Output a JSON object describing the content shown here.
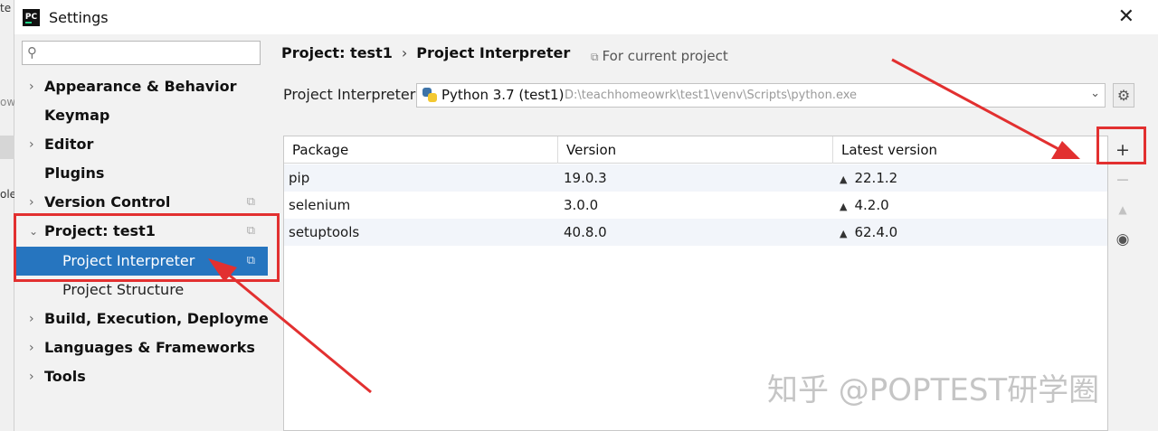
{
  "background_app": {
    "fragment_1": "te",
    "fragment_2": "ow",
    "fragment_3": "ole"
  },
  "window": {
    "title": "Settings",
    "close_glyph": "✕",
    "app_icon_text": "PC"
  },
  "sidebar": {
    "search_placeholder": "",
    "items": [
      {
        "label": "Appearance & Behavior",
        "expandable": true,
        "expanded": false
      },
      {
        "label": "Keymap",
        "expandable": false
      },
      {
        "label": "Editor",
        "expandable": true,
        "expanded": false
      },
      {
        "label": "Plugins",
        "expandable": false
      },
      {
        "label": "Version Control",
        "expandable": true,
        "expanded": false
      },
      {
        "label": "Project: test1",
        "expandable": true,
        "expanded": true
      },
      {
        "label": "Project Interpreter",
        "selected": true
      },
      {
        "label": "Project Structure"
      },
      {
        "label": "Build, Execution, Deployment",
        "expandable": true,
        "expanded": false
      },
      {
        "label": "Languages & Frameworks",
        "expandable": true,
        "expanded": false
      },
      {
        "label": "Tools",
        "expandable": true,
        "expanded": false
      }
    ]
  },
  "main": {
    "breadcrumb": {
      "parent": "Project: test1",
      "separator": "›",
      "current": "Project Interpreter"
    },
    "scope_label": "For current project",
    "interpreter": {
      "label": "Project Interpreter:",
      "name": "Python 3.7 (test1)",
      "path": "D:\\teachhomeowrk\\test1\\venv\\Scripts\\python.exe"
    },
    "table": {
      "columns": [
        "Package",
        "Version",
        "Latest version"
      ],
      "rows": [
        {
          "package": "pip",
          "version": "19.0.3",
          "latest": "22.1.2"
        },
        {
          "package": "selenium",
          "version": "3.0.0",
          "latest": "4.2.0"
        },
        {
          "package": "setuptools",
          "version": "40.8.0",
          "latest": "62.4.0"
        }
      ]
    },
    "tools": {
      "add": "+",
      "remove": "−",
      "upgrade": "▲",
      "show_early": "◉"
    }
  },
  "watermark": "知乎 @POPTEST研学圈",
  "colors": {
    "selection": "#2675bf",
    "annotation": "#e23030",
    "panel": "#f2f2f2"
  }
}
